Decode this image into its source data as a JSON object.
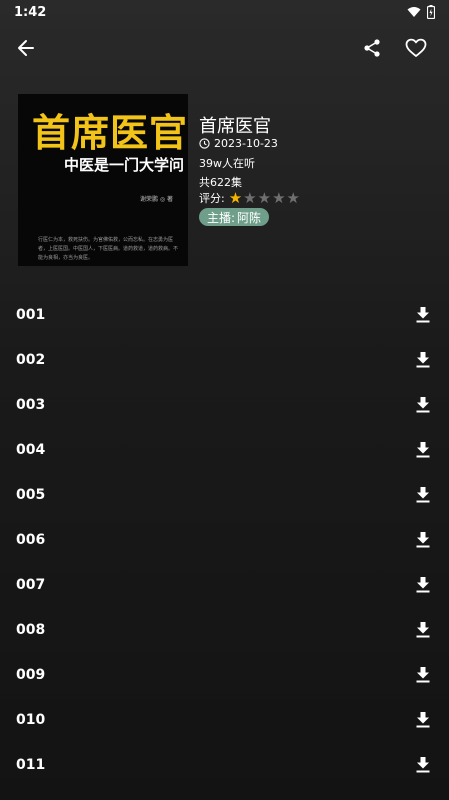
{
  "status": {
    "time": "1:42"
  },
  "book": {
    "title": "首席医官",
    "date": "2023-10-23",
    "listeners": "39w人在听",
    "episode_count": "共622集",
    "rating_label": "评分:",
    "rating": 1,
    "rating_max": 5,
    "host_label": "主播:",
    "host_name": "阿陈"
  },
  "cover": {
    "title": "首席医官",
    "subtitle": "中医是一门大学问",
    "author": "谢荣鹏 ◎ 著",
    "blurb": "行医仁为本，救死扶伤。为官佛佑救，公而忘私。在志勇为医者，上医医国。中医国人，下医医病。道药救道，道药救病。不能为良相，亦当为良医。"
  },
  "episodes": [
    "001",
    "002",
    "003",
    "004",
    "005",
    "006",
    "007",
    "008",
    "009",
    "010",
    "011"
  ],
  "colors": {
    "star_on": "#f5b400",
    "star_off": "#6f6f6f",
    "host_badge": "#6f9e8b",
    "cover_title": "#f2c318"
  }
}
